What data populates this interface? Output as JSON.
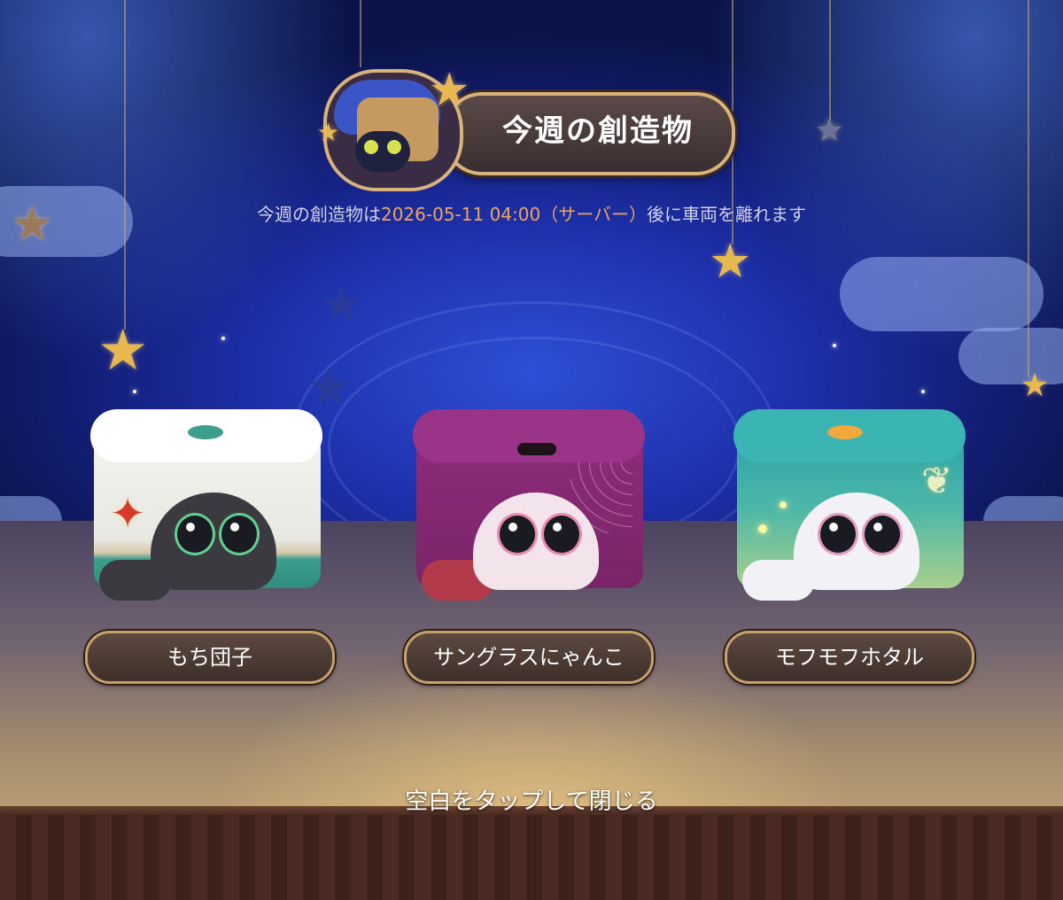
{
  "title": "今週の創造物",
  "notice": {
    "prefix": "今週の創造物は",
    "datetime": "2026-05-11 04:00（サーバー）",
    "suffix": "後に車両を離れます"
  },
  "creatures": [
    {
      "name": "もち団子",
      "icon": "mochi-dango-creature"
    },
    {
      "name": "サングラスにゃんこ",
      "icon": "sunglasses-cat-creature"
    },
    {
      "name": "モフモフホタル",
      "icon": "fluffy-firefly-creature"
    }
  ],
  "close_hint": "空白をタップして閉じる",
  "colors": {
    "accent_gold": "#d8b47c",
    "highlight_orange": "#f0a35a",
    "stage_blue": "#1d2fa8"
  }
}
